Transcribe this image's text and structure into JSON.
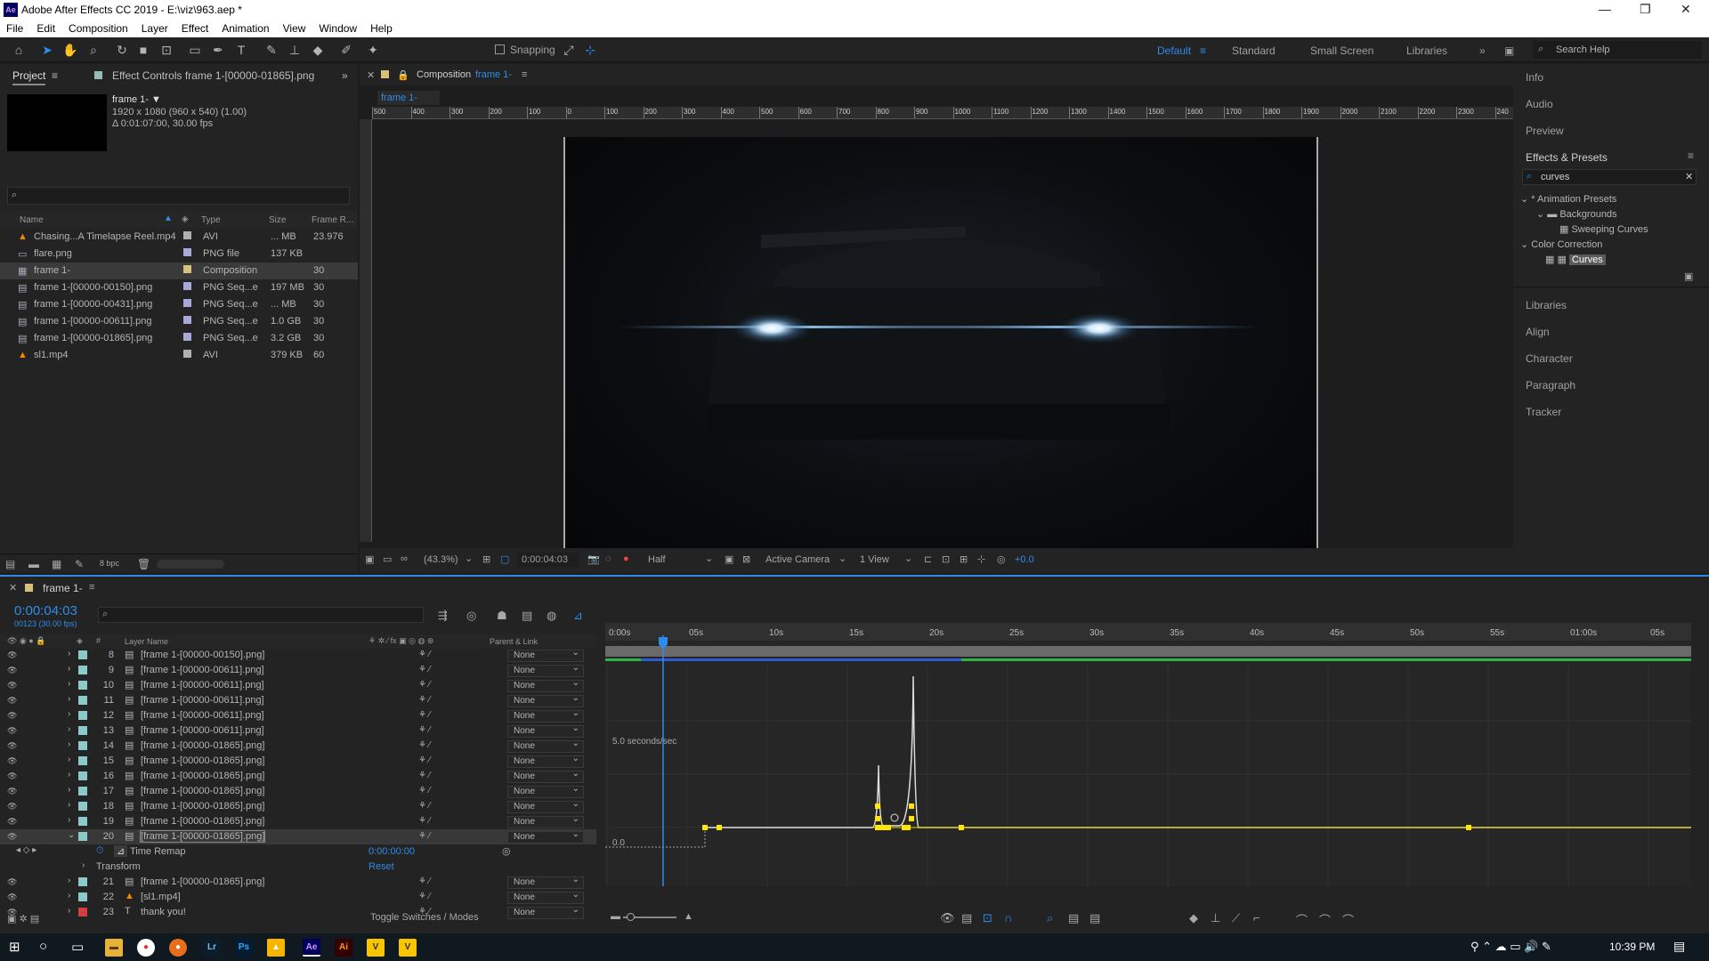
{
  "app": {
    "title": "Adobe After Effects CC 2019 - E:\\viz\\963.aep *",
    "logo": "Ae"
  },
  "window_controls": {
    "minimize": "—",
    "maximize": "❐",
    "close": "✕"
  },
  "menu": [
    "File",
    "Edit",
    "Composition",
    "Layer",
    "Effect",
    "Animation",
    "View",
    "Window",
    "Help"
  ],
  "toolbar": {
    "snapping": "Snapping",
    "workspaces": [
      "Default",
      "Standard",
      "Small Screen",
      "Libraries"
    ],
    "search_help": "Search Help"
  },
  "project": {
    "tab": "Project",
    "effect_controls": "Effect Controls frame 1-[00000-01865].png",
    "selected": {
      "name": "frame 1- ▼",
      "dims": "1920 x 1080 (960 x 540) (1.00)",
      "duration": "Δ 0:01:07:00, 30.00 fps"
    },
    "columns": {
      "name": "Name",
      "type": "Type",
      "size": "Size",
      "frame_rate": "Frame R..."
    },
    "items": [
      {
        "name": "Chasing...A Timelapse Reel.mp4",
        "type": "AVI",
        "size": "... MB",
        "fps": "23.976",
        "icon": "vlc-icon",
        "color": "#b0b0b0"
      },
      {
        "name": "flare.png",
        "type": "PNG file",
        "size": "137 KB",
        "fps": "",
        "icon": "image-icon",
        "color": "#a8a8d8"
      },
      {
        "name": "frame 1-",
        "type": "Composition",
        "size": "",
        "fps": "30",
        "icon": "composition-icon",
        "color": "#d8c07a"
      },
      {
        "name": "frame 1-[00000-00150].png",
        "type": "PNG Seq...e",
        "size": "197 MB",
        "fps": "30",
        "icon": "sequence-icon",
        "color": "#a8a8d8"
      },
      {
        "name": "frame 1-[00000-00431].png",
        "type": "PNG Seq...e",
        "size": "... MB",
        "fps": "30",
        "icon": "sequence-icon",
        "color": "#a8a8d8"
      },
      {
        "name": "frame 1-[00000-00611].png",
        "type": "PNG Seq...e",
        "size": "1.0 GB",
        "fps": "30",
        "icon": "sequence-icon",
        "color": "#a8a8d8"
      },
      {
        "name": "frame 1-[00000-01865].png",
        "type": "PNG Seq...e",
        "size": "3.2 GB",
        "fps": "30",
        "icon": "sequence-icon",
        "color": "#a8a8d8"
      },
      {
        "name": "sl1.mp4",
        "type": "AVI",
        "size": "379 KB",
        "fps": "60",
        "icon": "vlc-icon",
        "color": "#b0b0b0"
      }
    ],
    "bpc": "8 bpc"
  },
  "composition": {
    "tab_prefix": "Composition",
    "tab_name": "frame 1-",
    "sub_tab": "frame 1-",
    "ruler_labels": [
      "500",
      "400",
      "300",
      "200",
      "100",
      "0",
      "100",
      "200",
      "300",
      "400",
      "500",
      "600",
      "700",
      "800",
      "900",
      "1000",
      "1100",
      "1200",
      "1300",
      "1400",
      "1500",
      "1600",
      "1700",
      "1800",
      "1900",
      "2000",
      "2100",
      "2200",
      "2300",
      "240"
    ],
    "zoom": "(43.3%)",
    "timecode": "0:00:04:03",
    "resolution": "Half",
    "camera": "Active Camera",
    "views": "1 View",
    "exposure": "+0.0"
  },
  "right_panels": {
    "panels": [
      "Info",
      "Audio",
      "Preview"
    ],
    "effects_title": "Effects & Presets",
    "search": "curves",
    "tree": [
      {
        "label": "* Animation Presets",
        "depth": 0
      },
      {
        "label": "Backgrounds",
        "depth": 1
      },
      {
        "label": "Sweeping Curves",
        "depth": 2
      },
      {
        "label": "Color Correction",
        "depth": 0
      },
      {
        "label": "Curves",
        "depth": 1,
        "selected": true
      }
    ],
    "lower_panels": [
      "Libraries",
      "Align",
      "Character",
      "Paragraph",
      "Tracker"
    ]
  },
  "timeline": {
    "tab": "frame 1-",
    "time": "0:00:04:03",
    "frames": "00123 (30.00 fps)",
    "headers": {
      "layer_name": "Layer Name",
      "parent": "Parent & Link"
    },
    "layers": [
      {
        "num": "8",
        "name": "[frame 1-[00000-00150].png]",
        "parent": "None"
      },
      {
        "num": "9",
        "name": "[frame 1-[00000-00611].png]",
        "parent": "None"
      },
      {
        "num": "10",
        "name": "[frame 1-[00000-00611].png]",
        "parent": "None"
      },
      {
        "num": "11",
        "name": "[frame 1-[00000-00611].png]",
        "parent": "None"
      },
      {
        "num": "12",
        "name": "[frame 1-[00000-00611].png]",
        "parent": "None"
      },
      {
        "num": "13",
        "name": "[frame 1-[00000-00611].png]",
        "parent": "None"
      },
      {
        "num": "14",
        "name": "[frame 1-[00000-01865].png]",
        "parent": "None"
      },
      {
        "num": "15",
        "name": "[frame 1-[00000-01865].png]",
        "parent": "None"
      },
      {
        "num": "16",
        "name": "[frame 1-[00000-01865].png]",
        "parent": "None"
      },
      {
        "num": "17",
        "name": "[frame 1-[00000-01865].png]",
        "parent": "None"
      },
      {
        "num": "18",
        "name": "[frame 1-[00000-01865].png]",
        "parent": "None"
      },
      {
        "num": "19",
        "name": "[frame 1-[00000-01865].png]",
        "parent": "None"
      },
      {
        "num": "20",
        "name": "[frame 1-[00000-01865].png]",
        "parent": "None",
        "selected": true
      }
    ],
    "time_remap": {
      "label": "Time Remap",
      "value": "0:00:00:00"
    },
    "transform": {
      "label": "Transform",
      "reset": "Reset"
    },
    "layers_after": [
      {
        "num": "21",
        "name": "[frame 1-[00000-01865].png]",
        "parent": "None",
        "color": "#8ec9c9"
      },
      {
        "num": "22",
        "name": "[sl1.mp4]",
        "parent": "None",
        "color": "#8ec9c9"
      },
      {
        "num": "23",
        "name": "thank you!",
        "parent": "None",
        "color": "#d04040"
      }
    ],
    "ruler": [
      "0:00s",
      "05s",
      "10s",
      "15s",
      "20s",
      "25s",
      "30s",
      "35s",
      "40s",
      "45s",
      "50s",
      "55s",
      "01:00s",
      "05s"
    ],
    "graph_label_top": "5.0 seconds/sec",
    "graph_label_bottom": "0.0",
    "toggle": "Toggle Switches / Modes"
  },
  "taskbar": {
    "clock": "10:39 PM",
    "apps": [
      "Lr",
      "Ps",
      "Ae",
      "Ai"
    ]
  }
}
